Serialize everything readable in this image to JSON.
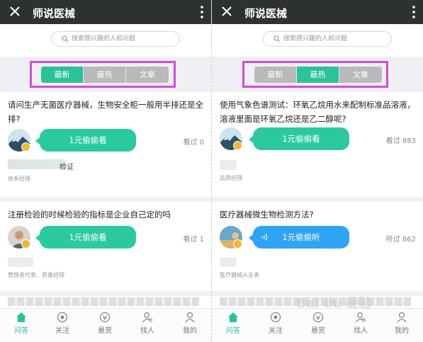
{
  "left": {
    "title": "师说医械",
    "search_placeholder": "搜索感兴趣的人和问题",
    "tabs": [
      {
        "label": "最新",
        "active": true
      },
      {
        "label": "最热",
        "active": false
      },
      {
        "label": "文章",
        "active": false
      }
    ],
    "cards": [
      {
        "question": "请问生产无菌医疗器械，生物安全柜一般用半排还是全排?",
        "button": "1元偷偷看",
        "views": "看过 0",
        "name": "检证",
        "role": "体系经理"
      },
      {
        "question": "注册检验的时候检验的指标是企业自己定的吗",
        "button": "1元偷偷看",
        "views": "看过 1",
        "name": "",
        "role": "管理者代表，质量经理"
      }
    ],
    "nav": [
      {
        "label": "问答",
        "icon": "home-icon",
        "active": true
      },
      {
        "label": "关注",
        "icon": "follow-icon",
        "active": false
      },
      {
        "label": "悬赏",
        "icon": "reward-icon",
        "active": false
      },
      {
        "label": "找人",
        "icon": "find-person-icon",
        "active": false
      },
      {
        "label": "我的",
        "icon": "profile-icon",
        "active": false
      }
    ]
  },
  "right": {
    "title": "师说医械",
    "search_placeholder": "搜索感兴趣的人和问题",
    "tabs": [
      {
        "label": "最新",
        "active": false
      },
      {
        "label": "最热",
        "active": true
      },
      {
        "label": "文章",
        "active": false
      }
    ],
    "cards": [
      {
        "question": "使用气象色谱测试：环氧乙烷用水来配制标准品溶液，溶液里面是环氧乙烷还是乙二醇呢?",
        "button": "1元偷偷看",
        "views": "看过 883",
        "name": "",
        "role": "品质经理"
      },
      {
        "question": "医疗器械微生物检测方法?",
        "button": "1元偷偷听",
        "views": "听过 862",
        "name": "",
        "role": "医疗器械从业者"
      }
    ],
    "nav": [
      {
        "label": "问答",
        "icon": "home-icon",
        "active": true
      },
      {
        "label": "关注",
        "icon": "follow-icon",
        "active": false
      },
      {
        "label": "悬赏",
        "icon": "reward-icon",
        "active": false
      },
      {
        "label": "找人",
        "icon": "find-person-icon",
        "active": false
      },
      {
        "label": "我的",
        "icon": "profile-icon",
        "active": false
      }
    ]
  },
  "watermark": "Bai du 经验",
  "colors": {
    "accent": "#2bc199",
    "listen_blue": "#2ea4f5",
    "highlight": "#d14cd6",
    "titlebar": "#2e3132"
  }
}
